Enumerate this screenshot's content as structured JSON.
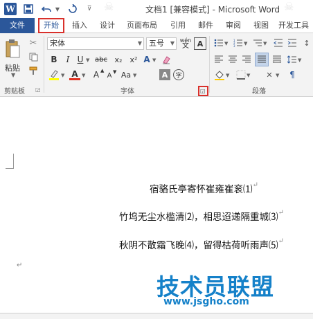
{
  "window": {
    "title": "文档1 [兼容模式] - Microsoft Word",
    "app_icon": "word-logo-icon"
  },
  "quick_access": [
    "save-icon",
    "undo-icon",
    "redo-icon",
    "customize-icon"
  ],
  "tabs": [
    {
      "label": "文件"
    },
    {
      "label": "开始"
    },
    {
      "label": "插入"
    },
    {
      "label": "设计"
    },
    {
      "label": "页面布局"
    },
    {
      "label": "引用"
    },
    {
      "label": "邮件"
    },
    {
      "label": "审阅"
    },
    {
      "label": "视图"
    },
    {
      "label": "开发工具"
    }
  ],
  "ribbon": {
    "clipboard": {
      "paste_label": "粘贴",
      "group_label": "剪贴板"
    },
    "font": {
      "font_name": "宋体",
      "font_size": "五号",
      "phonetic_label": "wén",
      "char_border_label": "A",
      "group_label": "字体",
      "bold": "B",
      "italic": "I",
      "underline": "U",
      "strike": "abc",
      "subscript": "x₂",
      "superscript": "x²",
      "enclose": "字",
      "grow": "A",
      "shrink": "A",
      "case": "Aa",
      "shade_char": "A"
    },
    "paragraph": {
      "group_label": "段落"
    }
  },
  "document": {
    "lines": [
      "宿骆氏亭寄怀崔雍崔衮⑴",
      "竹坞无尘水槛清⑵，相思迢递隔重城⑶",
      "秋阴不散霜飞晚⑷，留得枯荷听雨声⑸"
    ],
    "para_mark": "↵"
  },
  "watermark": {
    "text": "技术员联盟",
    "url": "www.jsgho.com"
  }
}
